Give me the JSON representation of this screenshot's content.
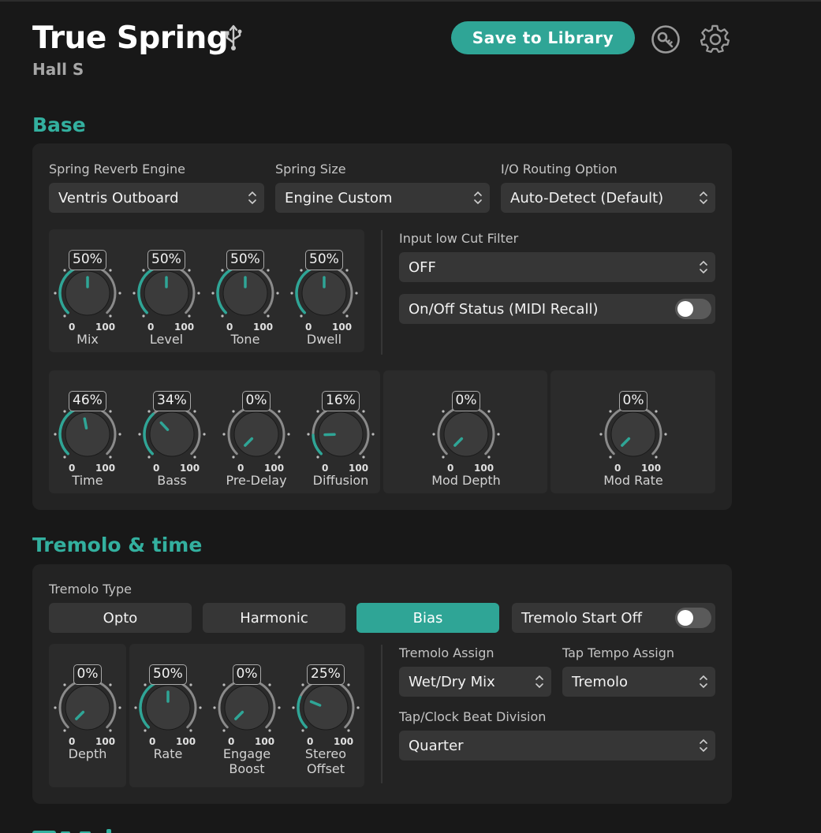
{
  "header": {
    "title": "True Spring",
    "subtitle": "Hall S",
    "save_label": "Save to Library",
    "icons": [
      "usb-icon",
      "key-icon",
      "gear-icon"
    ]
  },
  "colors": {
    "accent": "#2fa596",
    "section_title": "#33b09f",
    "background": "#181818",
    "panel": "#232323"
  },
  "base": {
    "title": "Base",
    "engine": {
      "label": "Spring Reverb Engine",
      "value": "Ventris Outboard"
    },
    "size": {
      "label": "Spring Size",
      "value": "Engine Custom"
    },
    "routing": {
      "label": "I/O Routing Option",
      "value": "Auto-Detect (Default)"
    },
    "lowcut": {
      "label": "Input low Cut Filter",
      "value": "OFF"
    },
    "midi_toggle": {
      "label": "On/Off Status (MIDI Recall)",
      "on": false
    },
    "knobs_top": [
      {
        "name": "Mix",
        "value": 50,
        "display": "50%",
        "min": "0",
        "max": "100"
      },
      {
        "name": "Level",
        "value": 50,
        "display": "50%",
        "min": "0",
        "max": "100"
      },
      {
        "name": "Tone",
        "value": 50,
        "display": "50%",
        "min": "0",
        "max": "100"
      },
      {
        "name": "Dwell",
        "value": 50,
        "display": "50%",
        "min": "0",
        "max": "100"
      }
    ],
    "knobs_bottom": [
      {
        "name": "Time",
        "value": 46,
        "display": "46%",
        "min": "0",
        "max": "100"
      },
      {
        "name": "Bass",
        "value": 34,
        "display": "34%",
        "min": "0",
        "max": "100"
      },
      {
        "name": "Pre-Delay",
        "value": 0,
        "display": "0%",
        "min": "0",
        "max": "100"
      },
      {
        "name": "Diffusion",
        "value": 16,
        "display": "16%",
        "min": "0",
        "max": "100"
      }
    ],
    "knob_mod_depth": {
      "name": "Mod Depth",
      "value": 0,
      "display": "0%",
      "min": "0",
      "max": "100"
    },
    "knob_mod_rate": {
      "name": "Mod Rate",
      "value": 0,
      "display": "0%",
      "min": "0",
      "max": "100"
    }
  },
  "tremolo": {
    "title": "Tremolo & time",
    "type_label": "Tremolo Type",
    "types": [
      "Opto",
      "Harmonic",
      "Bias"
    ],
    "active_type": "Bias",
    "start_off": {
      "label": "Tremolo Start Off",
      "on": false
    },
    "assign": {
      "label": "Tremolo Assign",
      "value": "Wet/Dry Mix"
    },
    "tap_assign": {
      "label": "Tap Tempo Assign",
      "value": "Tremolo"
    },
    "beat_division": {
      "label": "Tap/Clock Beat Division",
      "value": "Quarter"
    },
    "knob_depth": {
      "name": "Depth",
      "value": 0,
      "display": "0%",
      "min": "0",
      "max": "100"
    },
    "knobs": [
      {
        "name": "Rate",
        "value": 50,
        "display": "50%",
        "min": "0",
        "max": "100"
      },
      {
        "name": "Engage\nBoost",
        "value": 0,
        "display": "0%",
        "min": "0",
        "max": "100"
      },
      {
        "name": "Stereo\nOffset",
        "value": 25,
        "display": "25%",
        "min": "0",
        "max": "100"
      }
    ]
  }
}
